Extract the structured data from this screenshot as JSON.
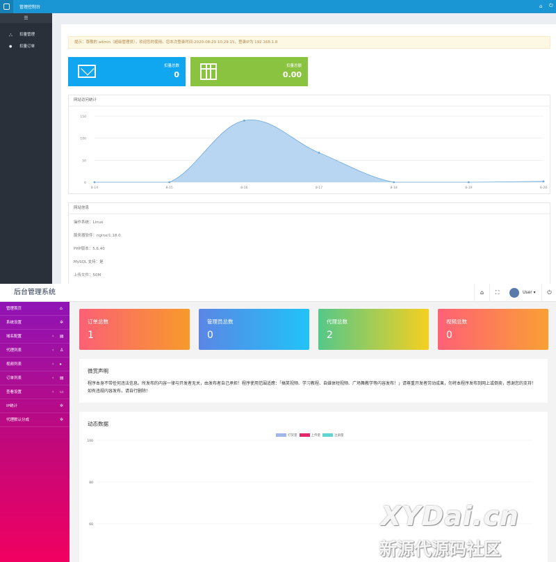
{
  "top": {
    "topbar": {
      "title": "管理控制台"
    },
    "sidebar": {
      "collapse_icon": "☰",
      "items": [
        {
          "label": "扣量管理",
          "icon": "sitemap-icon",
          "glyph": "⛬"
        },
        {
          "label": "扣量订单",
          "icon": "tag-icon",
          "glyph": "●"
        }
      ]
    },
    "notice": "提示：尊敬的 admin（超级管理员），欢迎您的使用。您本次登录时间:2020-08-20 10:29:15，登录IP为 192.168.1.8",
    "stats": [
      {
        "label": "扣量总数",
        "value": "0",
        "color": "#10a7f0",
        "icon": "envelope-icon"
      },
      {
        "label": "扣量总额",
        "value": "0.00",
        "color": "#8ac340",
        "icon": "table-icon"
      }
    ],
    "visits_panel": {
      "title": "网站访问统计"
    },
    "chart_data": {
      "type": "area",
      "title": "",
      "xlabel": "",
      "ylabel": "",
      "categories": [
        "8-14",
        "8-15",
        "8-16",
        "8-17",
        "8-18",
        "8-19",
        "8-20"
      ],
      "values": [
        0,
        0,
        140,
        67,
        0,
        0,
        2
      ],
      "ylim": [
        0,
        150
      ],
      "yticks": [
        "0",
        "50",
        "100",
        "150"
      ],
      "grid": true,
      "fill_color": "#b8d6f2",
      "line_color": "#6aa7dd"
    },
    "info_panel": {
      "title": "网站信息",
      "lines": [
        "操作系统：Linux",
        "服务器软件：nginx/1.18.0",
        "PHP版本：5.6.40",
        "MySQL 支持：是",
        "上传文件：50M"
      ]
    }
  },
  "bottom": {
    "brand": "后台管理系统",
    "header_icons": [
      "home-icon",
      "fullscreen-icon"
    ],
    "user": "User ▾",
    "power_icon": "power-icon",
    "sidebar": {
      "items": [
        {
          "label": "管理首页",
          "arrow": "",
          "glyph": "⌂"
        },
        {
          "label": "系统设置",
          "arrow": "",
          "glyph": "✲"
        },
        {
          "label": "域名配置",
          "arrow": "‹",
          "glyph": "▤"
        },
        {
          "label": "代理列表",
          "arrow": "‹",
          "glyph": "♙"
        },
        {
          "label": "视频列表",
          "arrow": "‹",
          "glyph": "▸"
        },
        {
          "label": "订单列表",
          "arrow": "‹",
          "glyph": "▤"
        },
        {
          "label": "查看设置",
          "arrow": "‹",
          "glyph": "▭"
        },
        {
          "label": "IP统计",
          "arrow": "",
          "glyph": "✲"
        },
        {
          "label": "代理默认分成",
          "arrow": "",
          "glyph": "✲"
        }
      ]
    },
    "cards": [
      {
        "label": "订单总数",
        "value": "1",
        "from": "#fc6076",
        "to": "#f79a2b"
      },
      {
        "label": "管理员总数",
        "value": "0",
        "from": "#5b86e5",
        "to": "#21c3f7"
      },
      {
        "label": "代理总数",
        "value": "2",
        "from": "#54c88a",
        "to": "#f5d020"
      },
      {
        "label": "视频总数",
        "value": "0",
        "from": "#ff6076",
        "to": "#f9a035"
      }
    ],
    "disclaimer": {
      "title": "微赏声明",
      "text": "程序本身不带任何违法信息。所发布的内容一律与开发者无关，由发布者自己承担！程序使用范围适應：「搞笑视频、学习教程、自媒体短视频、广场舞教学等内容发布！」请尊重开发者劳动成果，勿将本程序发布到网上或倒卖，感谢您的支持！如有违规内容发布，请自行删除！"
    },
    "dynamic_panel": {
      "title": "动态数据"
    },
    "chart_data": {
      "type": "line",
      "title": "",
      "series": [
        {
          "name": "打赏量",
          "color": "#9fb8e8",
          "values": []
        },
        {
          "name": "上传量",
          "color": "#e3276b",
          "values": []
        },
        {
          "name": "注册量",
          "color": "#5fd6cf",
          "values": []
        }
      ],
      "yticks": [
        "100",
        "80",
        "60"
      ],
      "ylim_visible": [
        60,
        100
      ],
      "grid": true,
      "legend": "top-center"
    }
  },
  "watermark": {
    "line1": "XYDai.cn",
    "line2": "新源代源码社区"
  }
}
